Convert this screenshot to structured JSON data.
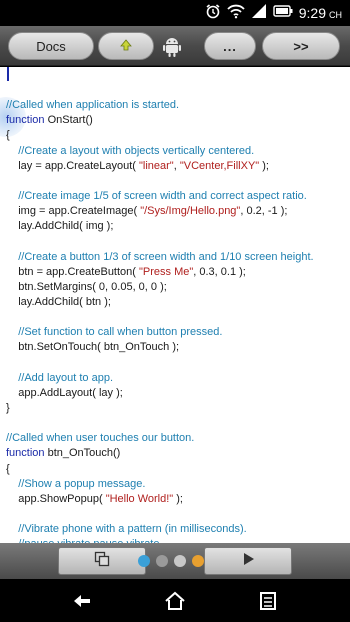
{
  "status_bar": {
    "time": "9:29",
    "period": "CH",
    "icons": [
      "alarm-icon",
      "wifi-icon",
      "signal-icon",
      "battery-icon"
    ]
  },
  "toolbar": {
    "docs_label": "Docs",
    "up_icon": "up-arrow-icon",
    "droid_icon": "android-icon",
    "more_label": "...",
    "next_label": ">>"
  },
  "code": {
    "lines": [
      [],
      [
        {
          "t": "//Called when application is started.",
          "c": "cm"
        }
      ],
      [
        {
          "t": "function",
          "c": "kw"
        },
        {
          "t": " OnStart()",
          "c": ""
        }
      ],
      [
        {
          "t": "{",
          "c": ""
        }
      ],
      [
        {
          "t": "    //Create a layout with objects vertically centered.",
          "c": "cm"
        }
      ],
      [
        {
          "t": "    lay = app.CreateLayout( ",
          "c": ""
        },
        {
          "t": "\"linear\"",
          "c": "st"
        },
        {
          "t": ", ",
          "c": ""
        },
        {
          "t": "\"VCenter,FillXY\"",
          "c": "st"
        },
        {
          "t": " );",
          "c": ""
        }
      ],
      [],
      [
        {
          "t": "    //Create image 1/5 of screen width and correct aspect ratio.",
          "c": "cm"
        }
      ],
      [
        {
          "t": "    img = app.CreateImage( ",
          "c": ""
        },
        {
          "t": "\"/Sys/Img/Hello.png\"",
          "c": "st"
        },
        {
          "t": ", 0.2, -1 );",
          "c": ""
        }
      ],
      [
        {
          "t": "    lay.AddChild( img );",
          "c": ""
        }
      ],
      [],
      [
        {
          "t": "    //Create a button 1/3 of screen width and 1/10 screen height.",
          "c": "cm"
        }
      ],
      [
        {
          "t": "    btn = app.CreateButton( ",
          "c": ""
        },
        {
          "t": "\"Press Me\"",
          "c": "st"
        },
        {
          "t": ", 0.3, 0.1 );",
          "c": ""
        }
      ],
      [
        {
          "t": "    btn.SetMargins( 0, 0.05, 0, 0 );",
          "c": ""
        }
      ],
      [
        {
          "t": "    lay.AddChild( btn );",
          "c": ""
        }
      ],
      [],
      [
        {
          "t": "    //Set function to call when button pressed.",
          "c": "cm"
        }
      ],
      [
        {
          "t": "    btn.SetOnTouch( btn_OnTouch );",
          "c": ""
        }
      ],
      [],
      [
        {
          "t": "    //Add layout to app.",
          "c": "cm"
        }
      ],
      [
        {
          "t": "    app.AddLayout( lay );",
          "c": ""
        }
      ],
      [
        {
          "t": "}",
          "c": ""
        }
      ],
      [],
      [
        {
          "t": "//Called when user touches our button.",
          "c": "cm"
        }
      ],
      [
        {
          "t": "function",
          "c": "kw"
        },
        {
          "t": " btn_OnTouch()",
          "c": ""
        }
      ],
      [
        {
          "t": "{",
          "c": ""
        }
      ],
      [
        {
          "t": "    //Show a popup message.",
          "c": "cm"
        }
      ],
      [
        {
          "t": "    app.ShowPopup( ",
          "c": ""
        },
        {
          "t": "\"Hello World!\"",
          "c": "st"
        },
        {
          "t": " );",
          "c": ""
        }
      ],
      [],
      [
        {
          "t": "    //Vibrate phone with a pattern (in milliseconds).",
          "c": "cm"
        }
      ],
      [
        {
          "t": "    //pause,vibrate,pause,vibrate",
          "c": "cm"
        }
      ]
    ]
  },
  "action_bar": {
    "copy_icon": "copy-icon",
    "play_icon": "play-icon",
    "dot_colors": [
      "#3aa0d8",
      "#9a9a9a",
      "#c8c8c8",
      "#e8a030",
      "#3a90d0",
      "#c83030"
    ]
  },
  "nav_bar": {
    "icons": [
      "back-icon",
      "home-icon",
      "recent-apps-icon"
    ]
  }
}
